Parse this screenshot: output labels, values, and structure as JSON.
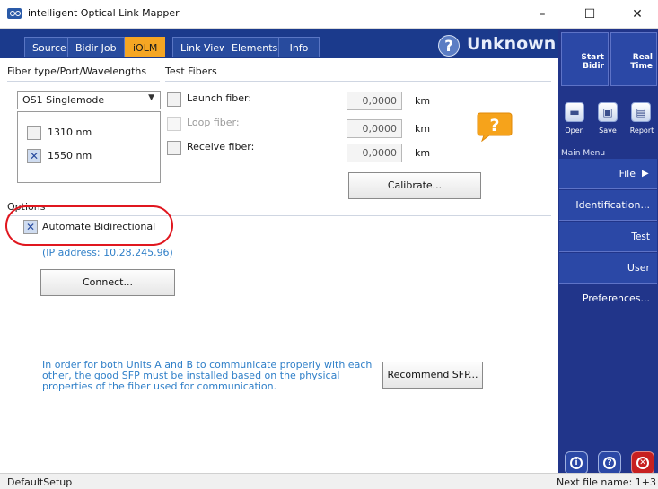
{
  "window": {
    "title": "intelligent Optical Link Mapper",
    "controls": {
      "minimize": "–",
      "maximize": "☐",
      "close": "✕"
    }
  },
  "tabs": [
    {
      "label": "Source",
      "active": false
    },
    {
      "label": "Bidir Job",
      "active": false
    },
    {
      "label": "iOLM",
      "active": true
    },
    {
      "label": "Link View",
      "active": false
    },
    {
      "label": "Elements",
      "active": false
    },
    {
      "label": "Info",
      "active": false
    }
  ],
  "status_header": {
    "icon": "question-icon",
    "label": "Unknown"
  },
  "fiber_section": {
    "heading": "Fiber type/Port/Wavelengths",
    "fiber_type": "OS1 Singlemode",
    "wavelengths": [
      {
        "label": "1310 nm",
        "checked": false
      },
      {
        "label": "1550 nm",
        "checked": true
      }
    ]
  },
  "test_fibers": {
    "heading": "Test Fibers",
    "rows": [
      {
        "label": "Launch fiber:",
        "value": "0,0000",
        "unit": "km",
        "enabled": true
      },
      {
        "label": "Loop fiber:",
        "value": "0,0000",
        "unit": "km",
        "enabled": false
      },
      {
        "label": "Receive fiber:",
        "value": "0,0000",
        "unit": "km",
        "enabled": true
      }
    ],
    "calibrate_label": "Calibrate..."
  },
  "options": {
    "heading": "Options",
    "automate_bidir_label": "Automate Bidirectional",
    "automate_bidir_checked": true,
    "ip_text": "(IP address: 10.28.245.96)",
    "connect_label": "Connect...",
    "info_line1": "In order for both Units A and B to communicate properly with each",
    "info_line2": "other, the good SFP must be installed based on the physical",
    "info_line3": "properties of the fiber used for communication.",
    "recommend_label": "Recommend SFP..."
  },
  "sidebar": {
    "start_bidir": "Start\nBidir",
    "real_time": "Real\nTime",
    "toolbar": [
      {
        "label": "Open",
        "icon": "folder-open-icon"
      },
      {
        "label": "Save",
        "icon": "save-icon"
      },
      {
        "label": "Report",
        "icon": "report-icon"
      }
    ],
    "main_menu_label": "Main Menu",
    "menu": [
      "File",
      "Identification...",
      "Test Configuration...",
      "User Preferences..."
    ],
    "bottom_icons": [
      "info-icon",
      "help-icon",
      "exit-icon"
    ],
    "accent_colors": {
      "tab_active": "#f5a623",
      "sidebar": "#21358a",
      "exit": "#d32a2a"
    }
  },
  "statusbar": {
    "left": "DefaultSetup",
    "right": "Next file name: 1+3"
  }
}
